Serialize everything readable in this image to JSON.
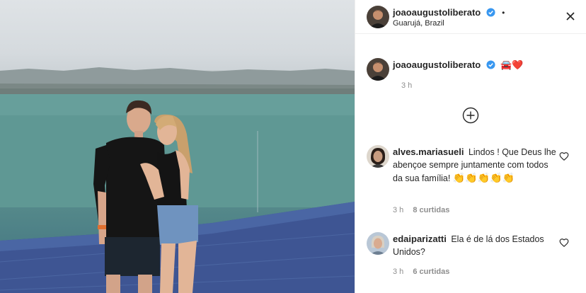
{
  "post": {
    "author": "joaoaugustoliberato",
    "location": "Guarujá, Brazil",
    "caption_emoji": "🚘❤️",
    "caption_time": "3 h"
  },
  "comments": [
    {
      "username": "alves.mariasueli",
      "text": "Lindos ! Que Deus lhe abençoe sempre juntamente com todos da sua família!",
      "emoji": "👏👏👏👏👏",
      "time": "3 h",
      "likes": "8 curtidas"
    },
    {
      "username": "edaiparizatti",
      "text": "Ela é de lá dos Estados Unidos?",
      "time": "3 h",
      "likes": "6 curtidas"
    }
  ],
  "colors": {
    "verified": "#3897f0",
    "text": "#262626",
    "muted": "#8e8e8e",
    "border": "#efefef",
    "heart": "#ed4956"
  },
  "icons": {
    "verified": "verified-badge-icon",
    "more": "more-options-icon",
    "plus": "load-more-comments-icon",
    "like": "heart-outline-icon"
  }
}
